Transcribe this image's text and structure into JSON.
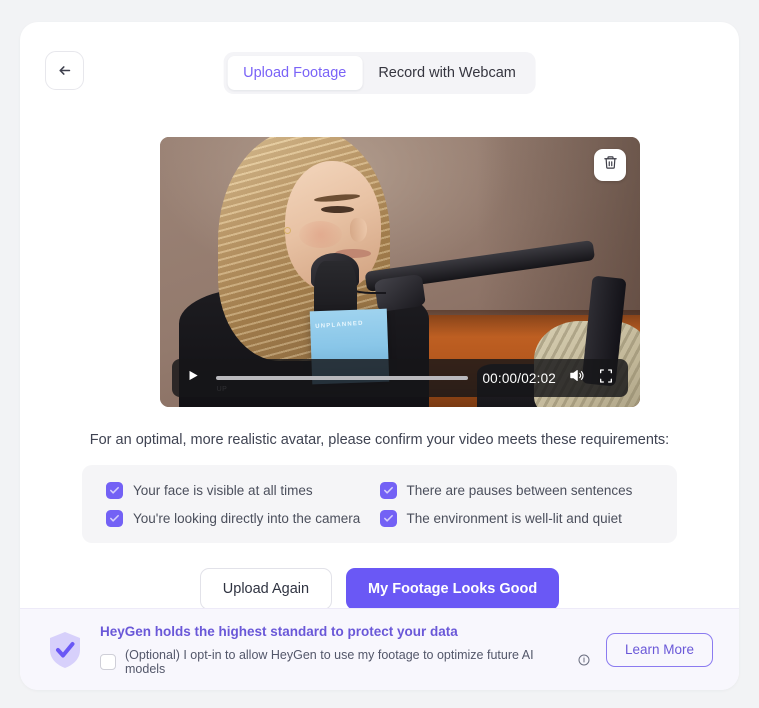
{
  "header": {
    "back_icon": "arrow-left-icon",
    "tabs": [
      {
        "label": "Upload Footage",
        "active": true
      },
      {
        "label": "Record with Webcam",
        "active": false
      }
    ]
  },
  "video": {
    "delete_icon": "trash-icon",
    "play_icon": "play-icon",
    "volume_icon": "volume-icon",
    "fullscreen_icon": "fullscreen-icon",
    "time_display": "00:00/02:02",
    "current_time": "00:00",
    "duration": "02:02",
    "progress_percent": 0,
    "overlay_label": "UNPLANNED"
  },
  "requirements": {
    "title": "For an optimal, more realistic avatar, please confirm your video meets these requirements:",
    "items": [
      {
        "label": "Your face is visible at all times",
        "checked": true
      },
      {
        "label": "There are pauses between sentences",
        "checked": true
      },
      {
        "label": "You're looking directly into the camera",
        "checked": true
      },
      {
        "label": "The environment is well-lit and quiet",
        "checked": true
      }
    ]
  },
  "actions": {
    "secondary_label": "Upload Again",
    "primary_label": "My Footage Looks Good"
  },
  "footer": {
    "shield_icon": "shield-check-icon",
    "title": "HeyGen holds the highest standard to protect your data",
    "optin_label": "(Optional) I opt-in to allow HeyGen to use my footage to optimize future AI models",
    "optin_checked": false,
    "info_icon": "info-icon",
    "learn_more_label": "Learn More"
  },
  "colors": {
    "accent_purple": "#6a58f5",
    "tab_active_text": "#7a63f7",
    "footer_bg": "#f8f7fd",
    "page_bg": "#f2f3f5",
    "panel_bg": "#f5f5f7"
  }
}
